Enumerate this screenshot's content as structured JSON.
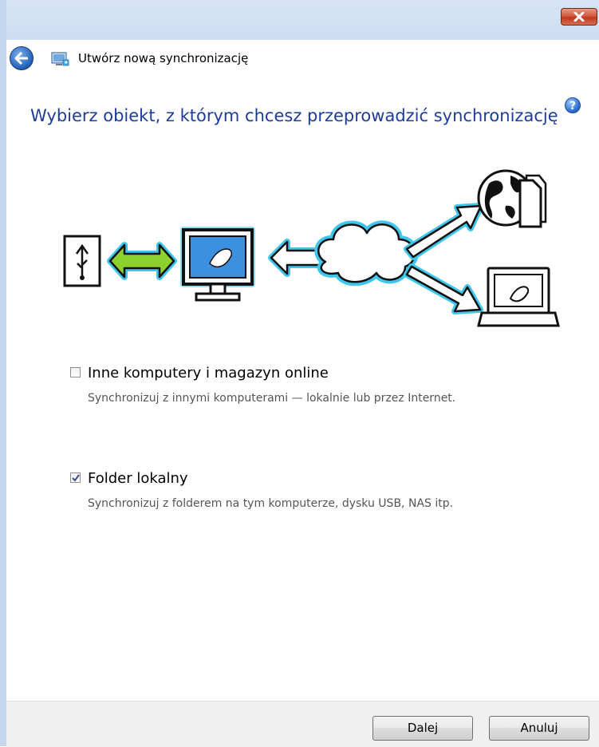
{
  "window": {
    "title": "Utwórz nową synchronizację"
  },
  "header": {
    "heading": "Wybierz obiekt, z którym chcesz przeprowadzić synchronizację"
  },
  "options": [
    {
      "label": "Inne komputery i magazyn online",
      "description": "Synchronizuj z innymi komputerami — lokalnie lub przez Internet.",
      "checked": false
    },
    {
      "label": "Folder lokalny",
      "description": "Synchronizuj z folderem na tym komputerze, dysku USB, NAS itp.",
      "checked": true
    }
  ],
  "buttons": {
    "next": "Dalej",
    "cancel": "Anuluj"
  },
  "icons": {
    "back": "back-arrow-icon",
    "app": "sync-app-icon",
    "help": "help-icon",
    "close": "close-icon"
  },
  "colors": {
    "heading": "#1e3c9c",
    "accent": "#3fc6ec"
  }
}
